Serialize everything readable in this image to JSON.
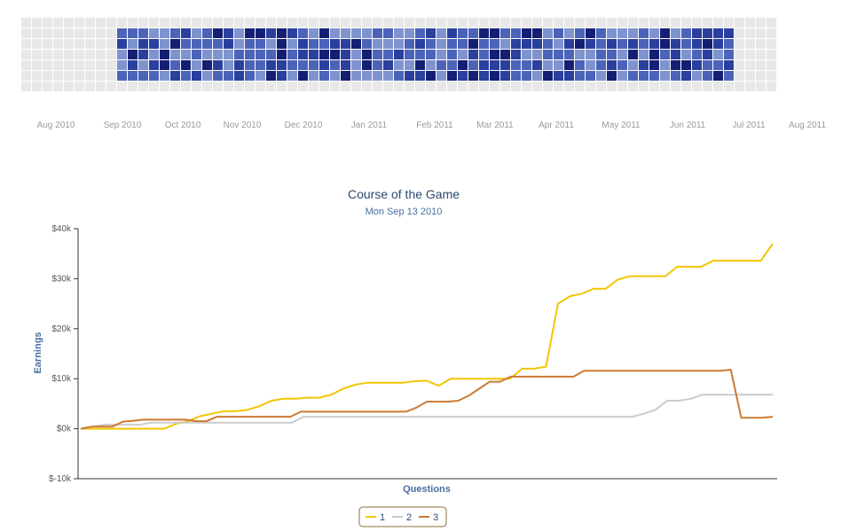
{
  "calendar": {
    "months": [
      "Aug 2010",
      "Sep 2010",
      "Oct 2010",
      "Nov 2010",
      "Dec 2010",
      "Jan 2011",
      "Feb 2011",
      "Mar 2011",
      "Apr 2011",
      "May 2011",
      "Jun 2011",
      "Jul 2011",
      "Aug 2011"
    ],
    "colors": {
      "empty": "#e8e8e8",
      "level1": "#7f93cf",
      "level2": "#4b63b8",
      "level3": "#2a3f9e",
      "level4": "#141f73"
    }
  },
  "chart_data": {
    "type": "line",
    "title": "Course of the Game",
    "subtitle": "Mon Sep 13 2010",
    "xlabel": "Questions",
    "ylabel": "Earnings",
    "yticks": [
      "$-10k",
      "$0k",
      "$10k",
      "$20k",
      "$30k",
      "$40k"
    ],
    "ylim": [
      -10000,
      40000
    ],
    "legend": {
      "position": "bottom-center"
    },
    "series": [
      {
        "name": "1",
        "color": "#f2c500",
        "values": [
          0,
          0,
          0,
          0,
          0,
          0,
          0,
          0,
          1000,
          1500,
          2500,
          3000,
          3500,
          3500,
          3800,
          4500,
          5600,
          6000,
          6000,
          6200,
          6200,
          6800,
          8000,
          8800,
          9200,
          9200,
          9200,
          9200,
          9500,
          9600,
          8600,
          10000,
          10000,
          10000,
          10000,
          10000,
          10000,
          12000,
          12000,
          12400,
          25000,
          26500,
          27000,
          28000,
          28000,
          29800,
          30500,
          30500,
          30500,
          30500,
          32400,
          32400,
          32400,
          33600,
          33600,
          33600,
          33600,
          33600,
          37000
        ]
      },
      {
        "name": "2",
        "color": "#cccccc",
        "values": [
          0,
          400,
          800,
          800,
          800,
          800,
          1200,
          1200,
          1200,
          1200,
          1200,
          1200,
          1200,
          1200,
          1200,
          1200,
          1200,
          1200,
          1200,
          2400,
          2400,
          2400,
          2400,
          2400,
          2400,
          2400,
          2400,
          2400,
          2400,
          2400,
          2400,
          2400,
          2400,
          2400,
          2400,
          2400,
          2400,
          2400,
          2400,
          2400,
          2400,
          2400,
          2400,
          2400,
          2400,
          2400,
          2400,
          2400,
          3000,
          3800,
          5600,
          5600,
          6000,
          6800,
          6800,
          6800,
          6800,
          6800,
          6800,
          6800
        ]
      },
      {
        "name": "3",
        "color": "#cc7a33",
        "values": [
          0,
          400,
          400,
          400,
          1400,
          1600,
          1800,
          1800,
          1800,
          1800,
          1800,
          1500,
          1500,
          2400,
          2400,
          2400,
          2400,
          2400,
          2400,
          2400,
          2400,
          3400,
          3400,
          3400,
          3400,
          3400,
          3400,
          3400,
          3400,
          3400,
          3400,
          3400,
          4200,
          5400,
          5400,
          5400,
          5600,
          6600,
          8000,
          9400,
          9400,
          10400,
          10400,
          10400,
          10400,
          10400,
          10400,
          10400,
          11600,
          11600,
          11600,
          11600,
          11600,
          11600,
          11600,
          11600,
          11600,
          11600,
          11600,
          11600,
          11600,
          11600,
          11800,
          2200,
          2200,
          2200,
          2400
        ]
      }
    ]
  }
}
